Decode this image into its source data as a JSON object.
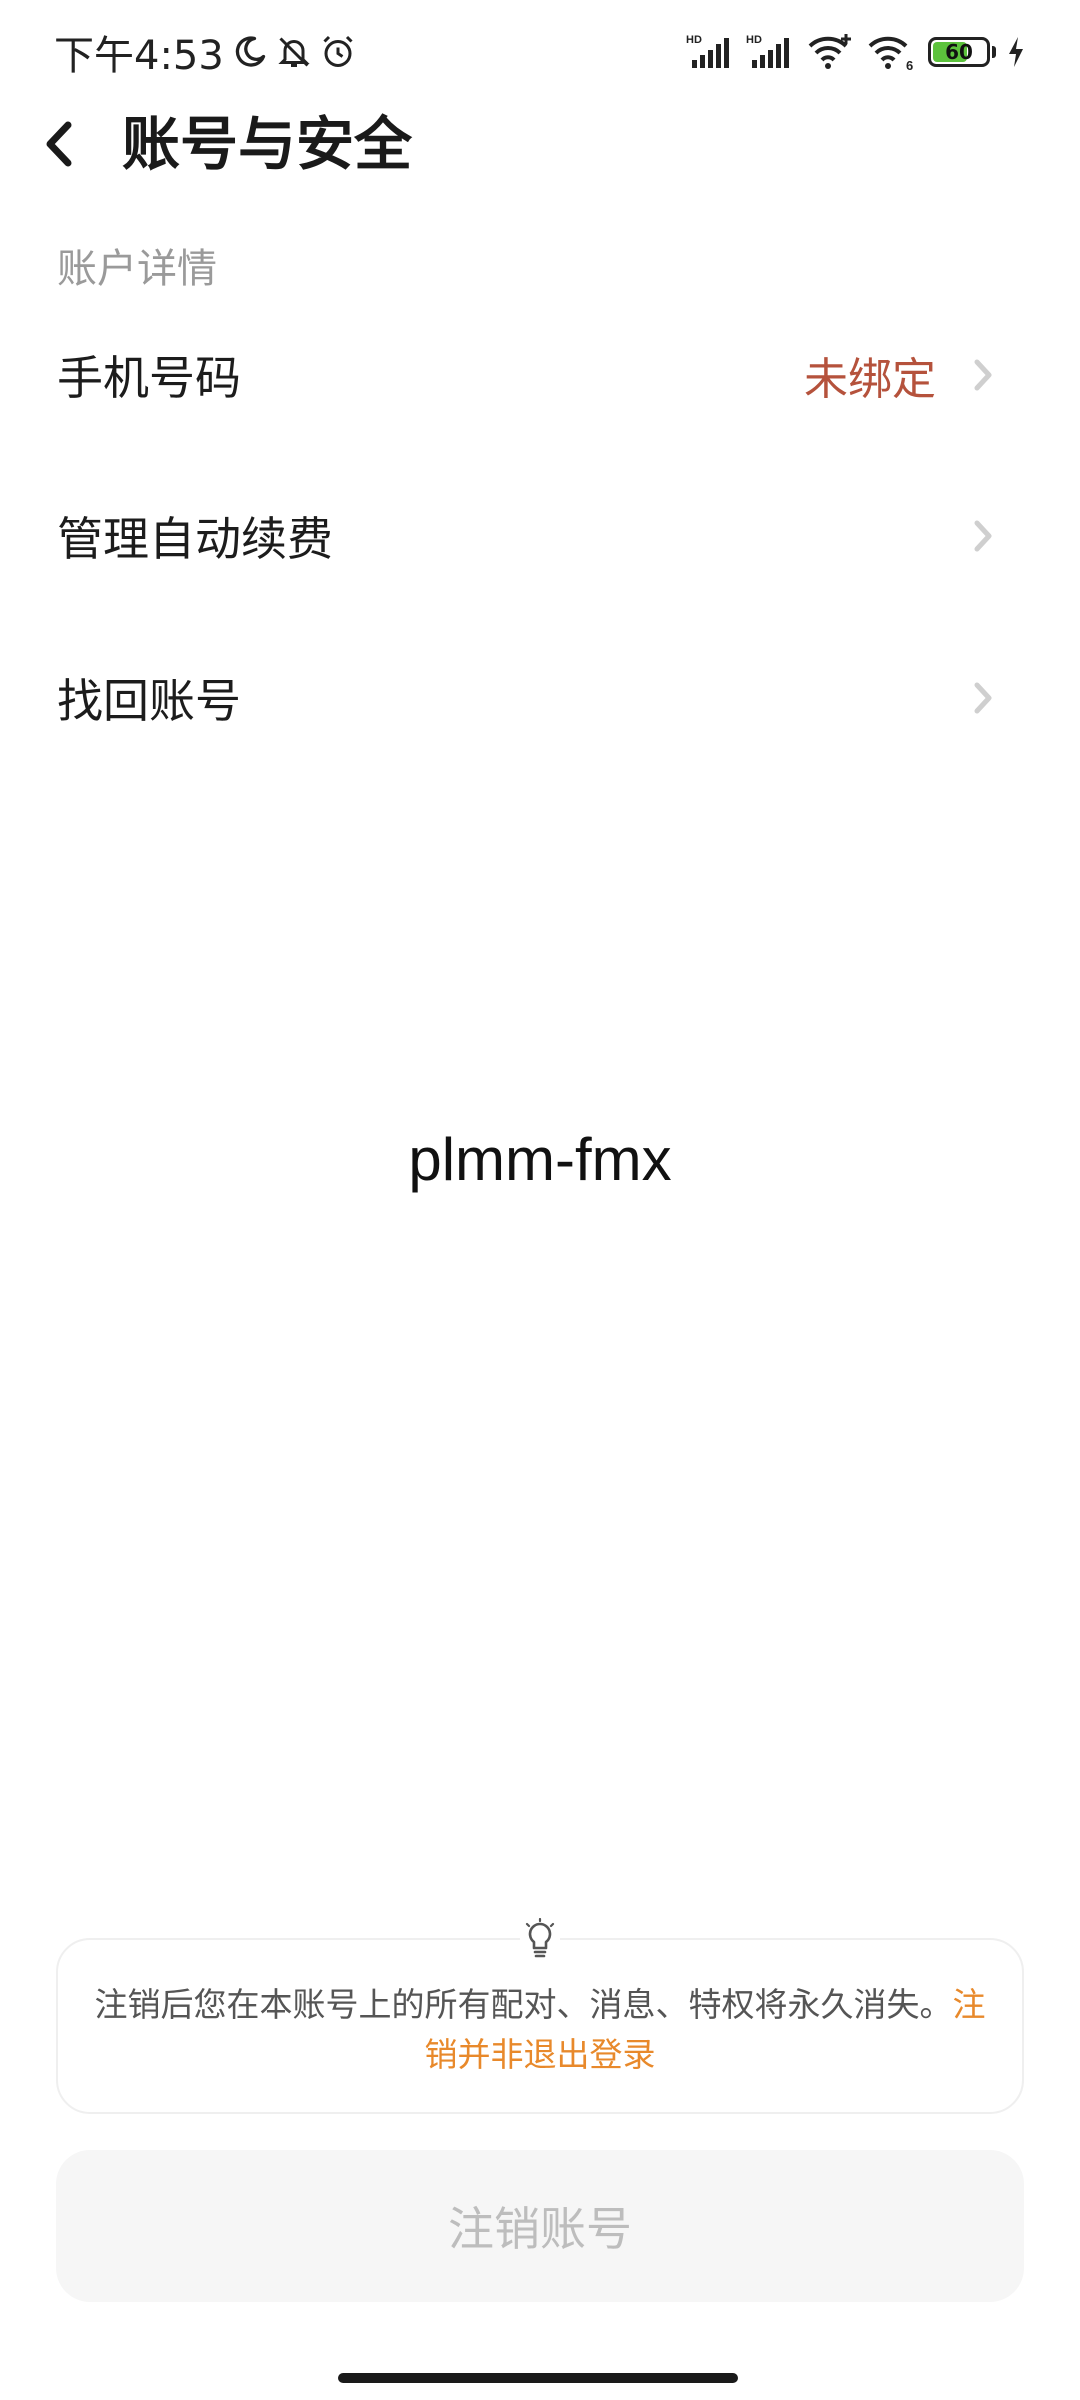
{
  "status_bar": {
    "time": "下午4:53",
    "left_icons": [
      "moon-icon",
      "bell-off-icon",
      "alarm-icon"
    ],
    "right_icons": [
      "hd-signal-1-icon",
      "hd-signal-2-icon",
      "wifi-plus-icon",
      "wifi-6-icon",
      "battery-icon",
      "charging-icon"
    ],
    "hd_label": "HD",
    "wifi_badge": "6",
    "battery_level": "60",
    "battery_color": "#5cc23c"
  },
  "header": {
    "back_icon": "chevron-left-icon",
    "title": "账号与安全"
  },
  "section": {
    "label": "账户详情",
    "items": [
      {
        "label": "手机号码",
        "value": "未绑定",
        "value_color": "#b5523c"
      },
      {
        "label": "管理自动续费",
        "value": ""
      },
      {
        "label": "找回账号",
        "value": ""
      }
    ]
  },
  "center_text": "plmm-fmx",
  "notice": {
    "icon": "lightbulb-icon",
    "text": "注销后您在本账号上的所有配对、消息、特权将永久消失。",
    "link_text": "注销并非退出登录",
    "link_color": "#e8892b"
  },
  "cancel_button": {
    "label": "注销账号"
  }
}
